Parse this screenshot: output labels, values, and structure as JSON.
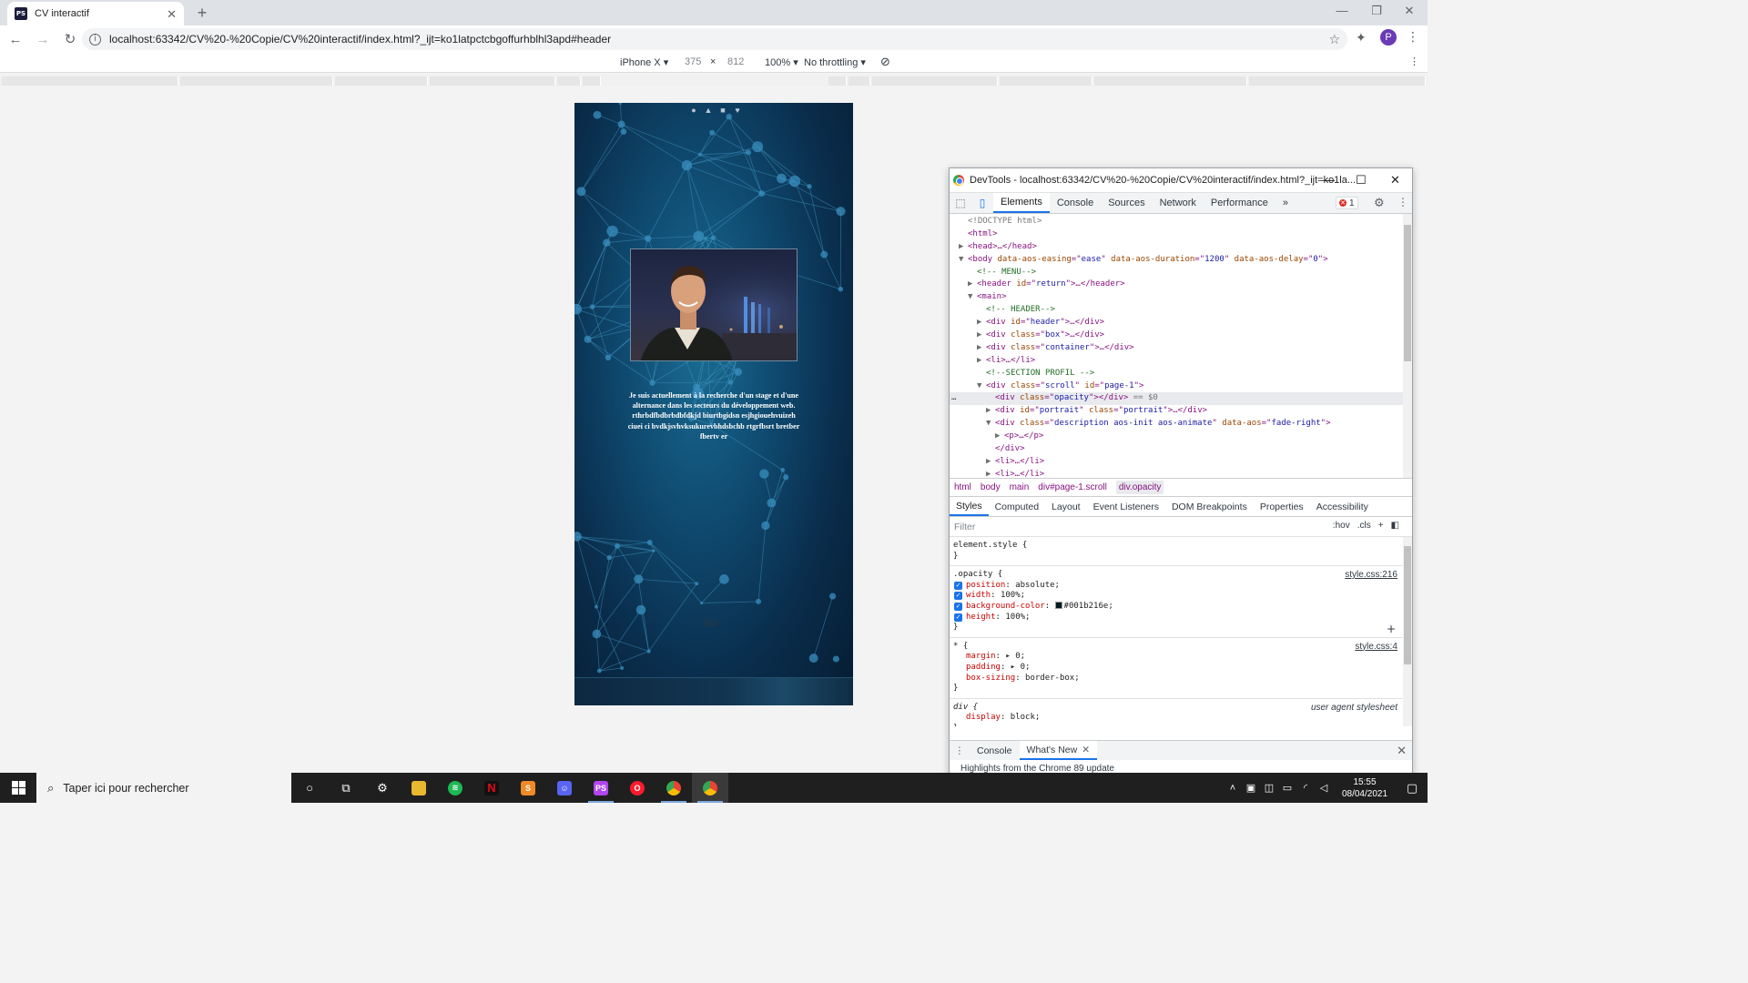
{
  "browser": {
    "tab_title": "CV interactif",
    "tab_favicon_text": "PS",
    "url": "localhost:63342/CV%20-%20Copie/CV%20interactif/index.html?_ijt=ko1latpctcbgoffurhblhl3apd#header",
    "profile_initial": "P"
  },
  "device_toolbar": {
    "device": "iPhone X",
    "width": "375",
    "height": "812",
    "zoom": "100%",
    "throttling": "No throttling"
  },
  "page": {
    "description": "Je suis actuellement à la recherche d'un stage et d'une alternance dans les secteurs du développement web. rthrbdfbdbrbdbfdkjd biurtbgidsn esjhgiouehvuizeh ciuei ci bvdkjsvhvksukurevbhdsbchb rtgrfbsrt bretber fbertv er",
    "scroll_indicator": "⊙⊙"
  },
  "devtools": {
    "title": "DevTools - localhost:63342/CV%20-%20Copie/CV%20interactif/index.html?_ijt=ko1la...",
    "tabs": [
      "Elements",
      "Console",
      "Sources",
      "Network",
      "Performance"
    ],
    "overflow": "»",
    "error_count": "1",
    "dom": [
      {
        "indent": 0,
        "tri": "",
        "type": "doc",
        "text": "<!DOCTYPE html>"
      },
      {
        "indent": 0,
        "tri": "",
        "type": "tag",
        "text": "<html>"
      },
      {
        "indent": 0,
        "tri": "▶",
        "type": "tag",
        "text": "<head>…</head>"
      },
      {
        "indent": 0,
        "tri": "▼",
        "type": "el",
        "tag": "body",
        "attrs": [
          [
            "data-aos-easing",
            "ease"
          ],
          [
            "data-aos-duration",
            "1200"
          ],
          [
            "data-aos-delay",
            "0"
          ]
        ],
        "close": ">"
      },
      {
        "indent": 1,
        "tri": "",
        "type": "cmt",
        "text": "<!-- MENU-->"
      },
      {
        "indent": 1,
        "tri": "▶",
        "type": "el",
        "tag": "header",
        "attrs": [
          [
            "id",
            "return"
          ]
        ],
        "close": ">…</header>"
      },
      {
        "indent": 1,
        "tri": "▼",
        "type": "tag",
        "text": "<main>"
      },
      {
        "indent": 2,
        "tri": "",
        "type": "cmt",
        "text": "<!-- HEADER-->"
      },
      {
        "indent": 2,
        "tri": "▶",
        "type": "el",
        "tag": "div",
        "attrs": [
          [
            "id",
            "header"
          ]
        ],
        "close": ">…</div>"
      },
      {
        "indent": 2,
        "tri": "▶",
        "type": "el",
        "tag": "div",
        "attrs": [
          [
            "class",
            "box"
          ]
        ],
        "close": ">…</div>"
      },
      {
        "indent": 2,
        "tri": "▶",
        "type": "el",
        "tag": "div",
        "attrs": [
          [
            "class",
            "container"
          ]
        ],
        "close": ">…</div>"
      },
      {
        "indent": 2,
        "tri": "▶",
        "type": "tag",
        "text": "<li>…</li>"
      },
      {
        "indent": 2,
        "tri": "",
        "type": "cmt",
        "text": "<!--SECTION PROFIL -->"
      },
      {
        "indent": 2,
        "tri": "▼",
        "type": "el",
        "tag": "div",
        "attrs": [
          [
            "class",
            "scroll"
          ],
          [
            "id",
            "page-1"
          ]
        ],
        "close": ">"
      },
      {
        "indent": 3,
        "tri": "",
        "type": "el",
        "tag": "div",
        "attrs": [
          [
            "class",
            "opacity"
          ]
        ],
        "close": "></div>",
        "suffix": " == $0",
        "selected": true
      },
      {
        "indent": 3,
        "tri": "▶",
        "type": "el",
        "tag": "div",
        "attrs": [
          [
            "id",
            "portrait"
          ],
          [
            "class",
            "portrait"
          ]
        ],
        "close": ">…</div>"
      },
      {
        "indent": 3,
        "tri": "▼",
        "type": "el",
        "tag": "div",
        "attrs": [
          [
            "class",
            "description aos-init aos-animate"
          ],
          [
            "data-aos",
            "fade-right"
          ]
        ],
        "close": ">"
      },
      {
        "indent": 4,
        "tri": "▶",
        "type": "tag",
        "text": "<p>…</p>"
      },
      {
        "indent": 3,
        "tri": "",
        "type": "tag",
        "text": "</div>"
      },
      {
        "indent": 3,
        "tri": "▶",
        "type": "tag",
        "text": "<li>…</li>"
      },
      {
        "indent": 3,
        "tri": "▶",
        "type": "tag",
        "text": "<li>…</li>"
      }
    ],
    "breadcrumbs": [
      "html",
      "body",
      "main",
      "div#page-1.scroll",
      "div.opacity"
    ],
    "subtabs": [
      "Styles",
      "Computed",
      "Layout",
      "Event Listeners",
      "DOM Breakpoints",
      "Properties",
      "Accessibility"
    ],
    "filter_placeholder": "Filter",
    "filter_hov": ":hov",
    "filter_cls": ".cls",
    "rules": [
      {
        "selector": "element.style {",
        "source": "",
        "decls": [],
        "checkbox": false,
        "end": "}"
      },
      {
        "selector": ".opacity {",
        "source": "style.css:216",
        "checkbox": true,
        "decls": [
          {
            "name": "position",
            "value": "absolute;"
          },
          {
            "name": "width",
            "value": "100%;"
          },
          {
            "name": "background-color",
            "value": "#001b216e;",
            "swatch": "#001b21"
          },
          {
            "name": "height",
            "value": "100%;"
          }
        ],
        "end": "}"
      },
      {
        "selector": "* {",
        "source": "style.css:4",
        "checkbox": false,
        "decls": [
          {
            "name": "margin",
            "value": "▸ 0;"
          },
          {
            "name": "padding",
            "value": "▸ 0;"
          },
          {
            "name": "box-sizing",
            "value": "border-box;"
          }
        ],
        "end": "}"
      },
      {
        "selector": "div {",
        "source": "user agent stylesheet",
        "checkbox": false,
        "ua": true,
        "decls": [
          {
            "name": "display",
            "value": "block;"
          }
        ],
        "end": "}"
      }
    ],
    "drawer_tabs": [
      "Console",
      "What's New"
    ],
    "drawer_text": "Highlights from the Chrome 89 update"
  },
  "taskbar": {
    "search_placeholder": "Taper ici pour rechercher",
    "time": "15:55",
    "date": "08/04/2021"
  }
}
